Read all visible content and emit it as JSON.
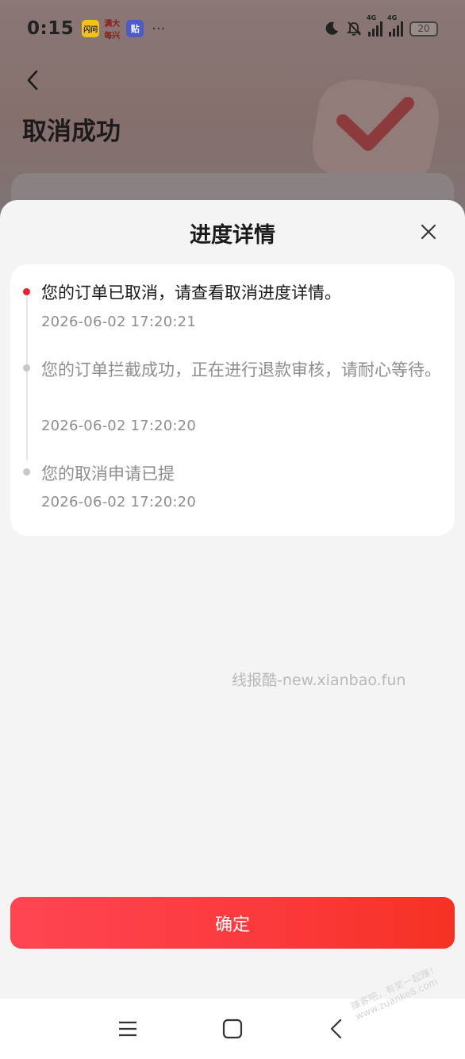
{
  "status_bar": {
    "time": "0:15",
    "apps": [
      "闪问",
      "满大每兴",
      "贴"
    ],
    "more": "···",
    "signal_label": "4G",
    "battery": "20"
  },
  "background_page": {
    "title": "取消成功"
  },
  "sheet": {
    "title": "进度详情",
    "timeline": [
      {
        "text": "您的订单已取消，请查看取消进度详情。",
        "time": "2026-06-02 17:20:21",
        "active": true
      },
      {
        "text": "您的订单拦截成功，正在进行退款审核，请耐心等待。",
        "time": "2026-06-02 17:20:20",
        "active": false
      },
      {
        "text": "您的取消申请已提",
        "time": "2026-06-02 17:20:20",
        "active": false
      }
    ],
    "watermark": "线报酷-new.xianbao.fun",
    "confirm_label": "确定"
  },
  "corner_watermark": {
    "line1": "赚客吧，有奖一起赚！",
    "line2": "www.zuanke8.com"
  },
  "colors": {
    "accent": "#e8232f",
    "button_start": "#ff4552",
    "button_end": "#f63223"
  }
}
